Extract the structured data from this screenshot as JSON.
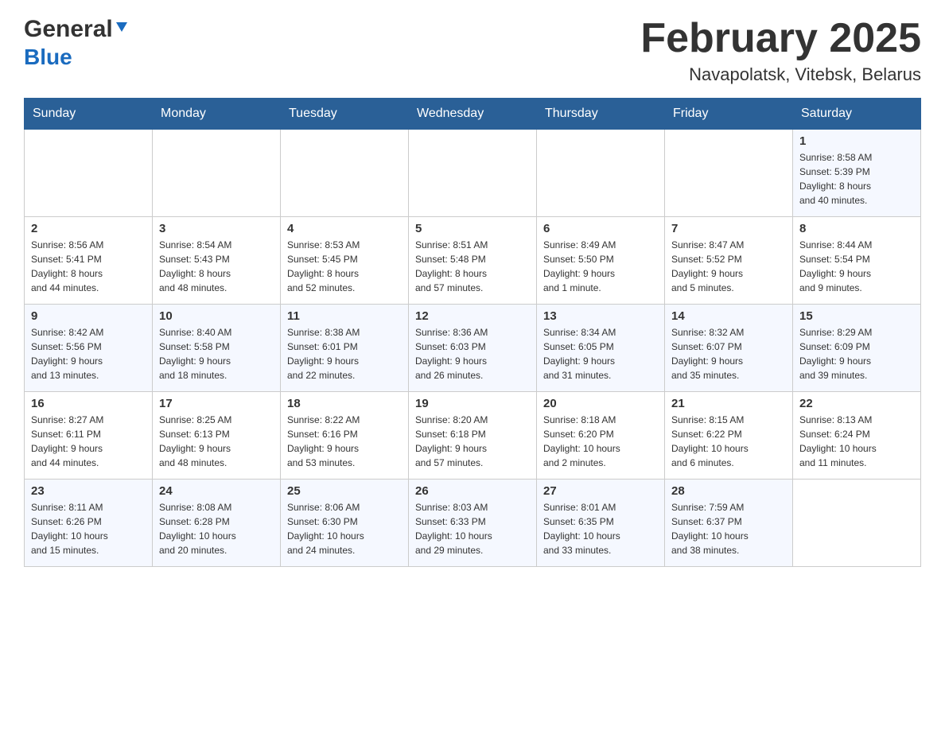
{
  "header": {
    "logo_general": "General",
    "logo_blue": "Blue",
    "month": "February 2025",
    "location": "Navapolatsk, Vitebsk, Belarus"
  },
  "days_of_week": [
    "Sunday",
    "Monday",
    "Tuesday",
    "Wednesday",
    "Thursday",
    "Friday",
    "Saturday"
  ],
  "weeks": [
    {
      "days": [
        {
          "num": "",
          "info": ""
        },
        {
          "num": "",
          "info": ""
        },
        {
          "num": "",
          "info": ""
        },
        {
          "num": "",
          "info": ""
        },
        {
          "num": "",
          "info": ""
        },
        {
          "num": "",
          "info": ""
        },
        {
          "num": "1",
          "info": "Sunrise: 8:58 AM\nSunset: 5:39 PM\nDaylight: 8 hours\nand 40 minutes."
        }
      ]
    },
    {
      "days": [
        {
          "num": "2",
          "info": "Sunrise: 8:56 AM\nSunset: 5:41 PM\nDaylight: 8 hours\nand 44 minutes."
        },
        {
          "num": "3",
          "info": "Sunrise: 8:54 AM\nSunset: 5:43 PM\nDaylight: 8 hours\nand 48 minutes."
        },
        {
          "num": "4",
          "info": "Sunrise: 8:53 AM\nSunset: 5:45 PM\nDaylight: 8 hours\nand 52 minutes."
        },
        {
          "num": "5",
          "info": "Sunrise: 8:51 AM\nSunset: 5:48 PM\nDaylight: 8 hours\nand 57 minutes."
        },
        {
          "num": "6",
          "info": "Sunrise: 8:49 AM\nSunset: 5:50 PM\nDaylight: 9 hours\nand 1 minute."
        },
        {
          "num": "7",
          "info": "Sunrise: 8:47 AM\nSunset: 5:52 PM\nDaylight: 9 hours\nand 5 minutes."
        },
        {
          "num": "8",
          "info": "Sunrise: 8:44 AM\nSunset: 5:54 PM\nDaylight: 9 hours\nand 9 minutes."
        }
      ]
    },
    {
      "days": [
        {
          "num": "9",
          "info": "Sunrise: 8:42 AM\nSunset: 5:56 PM\nDaylight: 9 hours\nand 13 minutes."
        },
        {
          "num": "10",
          "info": "Sunrise: 8:40 AM\nSunset: 5:58 PM\nDaylight: 9 hours\nand 18 minutes."
        },
        {
          "num": "11",
          "info": "Sunrise: 8:38 AM\nSunset: 6:01 PM\nDaylight: 9 hours\nand 22 minutes."
        },
        {
          "num": "12",
          "info": "Sunrise: 8:36 AM\nSunset: 6:03 PM\nDaylight: 9 hours\nand 26 minutes."
        },
        {
          "num": "13",
          "info": "Sunrise: 8:34 AM\nSunset: 6:05 PM\nDaylight: 9 hours\nand 31 minutes."
        },
        {
          "num": "14",
          "info": "Sunrise: 8:32 AM\nSunset: 6:07 PM\nDaylight: 9 hours\nand 35 minutes."
        },
        {
          "num": "15",
          "info": "Sunrise: 8:29 AM\nSunset: 6:09 PM\nDaylight: 9 hours\nand 39 minutes."
        }
      ]
    },
    {
      "days": [
        {
          "num": "16",
          "info": "Sunrise: 8:27 AM\nSunset: 6:11 PM\nDaylight: 9 hours\nand 44 minutes."
        },
        {
          "num": "17",
          "info": "Sunrise: 8:25 AM\nSunset: 6:13 PM\nDaylight: 9 hours\nand 48 minutes."
        },
        {
          "num": "18",
          "info": "Sunrise: 8:22 AM\nSunset: 6:16 PM\nDaylight: 9 hours\nand 53 minutes."
        },
        {
          "num": "19",
          "info": "Sunrise: 8:20 AM\nSunset: 6:18 PM\nDaylight: 9 hours\nand 57 minutes."
        },
        {
          "num": "20",
          "info": "Sunrise: 8:18 AM\nSunset: 6:20 PM\nDaylight: 10 hours\nand 2 minutes."
        },
        {
          "num": "21",
          "info": "Sunrise: 8:15 AM\nSunset: 6:22 PM\nDaylight: 10 hours\nand 6 minutes."
        },
        {
          "num": "22",
          "info": "Sunrise: 8:13 AM\nSunset: 6:24 PM\nDaylight: 10 hours\nand 11 minutes."
        }
      ]
    },
    {
      "days": [
        {
          "num": "23",
          "info": "Sunrise: 8:11 AM\nSunset: 6:26 PM\nDaylight: 10 hours\nand 15 minutes."
        },
        {
          "num": "24",
          "info": "Sunrise: 8:08 AM\nSunset: 6:28 PM\nDaylight: 10 hours\nand 20 minutes."
        },
        {
          "num": "25",
          "info": "Sunrise: 8:06 AM\nSunset: 6:30 PM\nDaylight: 10 hours\nand 24 minutes."
        },
        {
          "num": "26",
          "info": "Sunrise: 8:03 AM\nSunset: 6:33 PM\nDaylight: 10 hours\nand 29 minutes."
        },
        {
          "num": "27",
          "info": "Sunrise: 8:01 AM\nSunset: 6:35 PM\nDaylight: 10 hours\nand 33 minutes."
        },
        {
          "num": "28",
          "info": "Sunrise: 7:59 AM\nSunset: 6:37 PM\nDaylight: 10 hours\nand 38 minutes."
        },
        {
          "num": "",
          "info": ""
        }
      ]
    }
  ]
}
